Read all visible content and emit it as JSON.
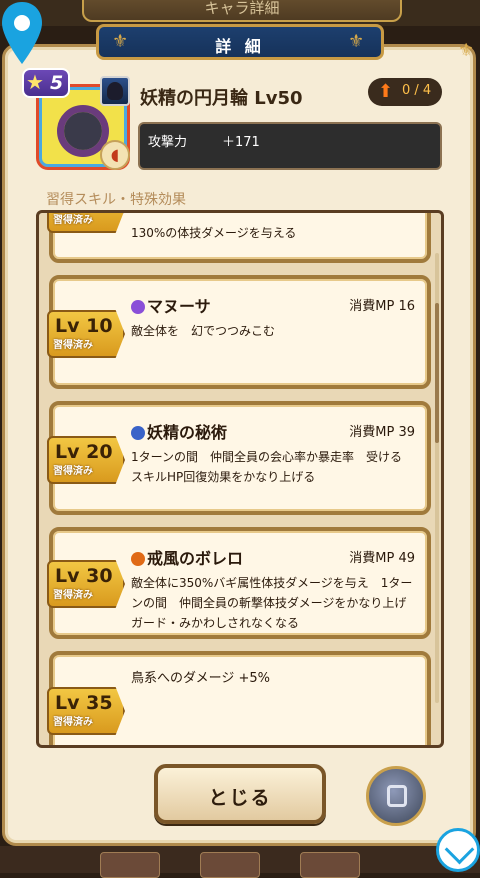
{
  "window": {
    "top_tab_title": "キャラ詳細"
  },
  "header": {
    "title": "詳 細"
  },
  "item": {
    "stars": "5",
    "name": "妖精の円月輪 Lv50",
    "enhance_count": "0 / 4",
    "stat_label": "攻撃力",
    "stat_value": "＋171"
  },
  "section": {
    "title": "習得スキル・特殊効果"
  },
  "skills": [
    {
      "level": "",
      "status": "習得済み",
      "name": "",
      "cost": "",
      "desc": "130%の体技ダメージを与える"
    },
    {
      "level": "Lv 10",
      "status": "習得済み",
      "name": "マヌーサ",
      "cost": "消費MP 16",
      "orb_color": "#8a4fd8",
      "desc": "敵全体を　幻でつつみこむ"
    },
    {
      "level": "Lv 20",
      "status": "習得済み",
      "name": "妖精の秘術",
      "cost": "消費MP 39",
      "orb_color": "#3a63c8",
      "desc": "1ターンの間　仲間全員の会心率か暴走率　受けるスキルHP回復効果をかなり上げる"
    },
    {
      "level": "Lv 30",
      "status": "習得済み",
      "name": "戒風のボレロ",
      "cost": "消費MP 49",
      "orb_color": "#e06a16",
      "desc": "敵全体に350%バギ属性体技ダメージを与え　1ターンの間　仲間全員の斬撃体技ダメージをかなり上げ　ガード・みかわしされなくなる"
    },
    {
      "level": "Lv 35",
      "status": "習得済み",
      "name": "",
      "cost": "",
      "desc": "鳥系へのダメージ +5%"
    }
  ],
  "footer": {
    "close_label": "とじる"
  },
  "colors": {
    "panel": "#f6ecd6",
    "header": "#1d3f6e",
    "gold": "#c89a44",
    "ribbon": "#f2c743"
  }
}
